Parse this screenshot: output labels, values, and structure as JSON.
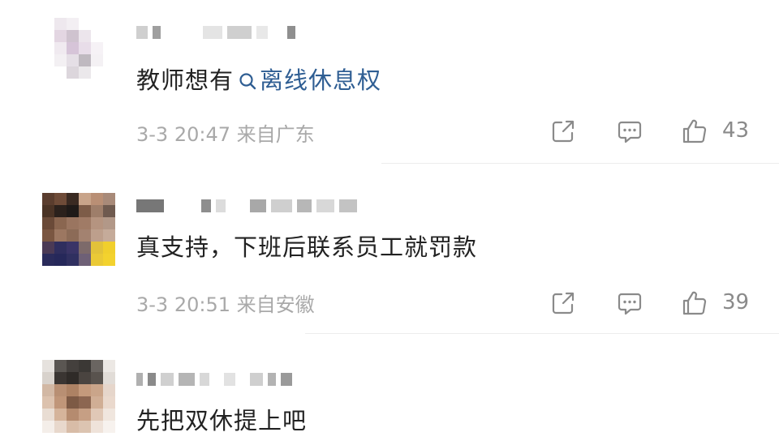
{
  "comments": [
    {
      "body_prefix": "教师想有",
      "topic_link": "离线休息权",
      "meta": "3-3 20:47 来自广东",
      "likes": "43"
    },
    {
      "body": "真支持，下班后联系员工就罚款",
      "meta": "3-3 20:51 来自安徽",
      "likes": "39"
    },
    {
      "body": "先把双休提上吧"
    }
  ],
  "icons": {
    "share": "share-icon",
    "comment": "comment-icon",
    "like": "like-icon",
    "search": "search-icon"
  },
  "colors": {
    "topic_link": "#2f5e93",
    "meta_text": "#a9a9a9",
    "action_icon": "#8a8a8a"
  }
}
